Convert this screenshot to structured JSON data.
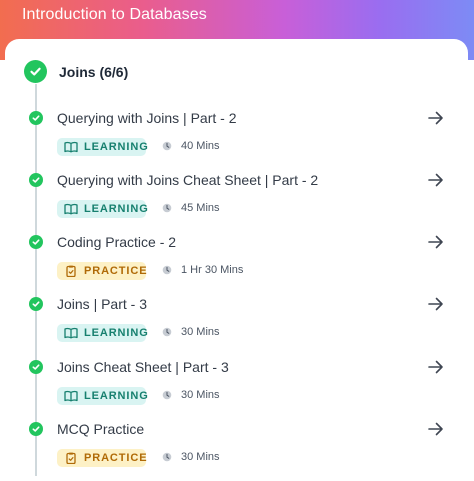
{
  "header": {
    "title": "Introduction to Databases"
  },
  "section": {
    "title": "Joins (6/6)"
  },
  "items": [
    {
      "title": "Querying with Joins | Part - 2",
      "type": "LEARNING",
      "duration": "40 Mins"
    },
    {
      "title": "Querying with Joins Cheat Sheet | Part - 2",
      "type": "LEARNING",
      "duration": "45 Mins"
    },
    {
      "title": "Coding Practice - 2",
      "type": "PRACTICE",
      "duration": "1 Hr 30 Mins"
    },
    {
      "title": "Joins | Part - 3",
      "type": "LEARNING",
      "duration": "30 Mins"
    },
    {
      "title": "Joins Cheat Sheet | Part - 3",
      "type": "LEARNING",
      "duration": "30 Mins"
    },
    {
      "title": "MCQ Practice",
      "type": "PRACTICE",
      "duration": "30 Mins"
    }
  ],
  "icons": {
    "section_status": "check-circle-icon",
    "item_status": "check-icon",
    "open": "arrow-right-icon",
    "learning": "book-icon",
    "practice": "clipboard-icon",
    "duration": "clock-icon"
  },
  "colors": {
    "done": "#22c55e",
    "learning_bg": "#d9f4f2",
    "learning_text": "#17806f",
    "practice_bg": "#fdf1c6",
    "practice_text": "#b06a07"
  }
}
